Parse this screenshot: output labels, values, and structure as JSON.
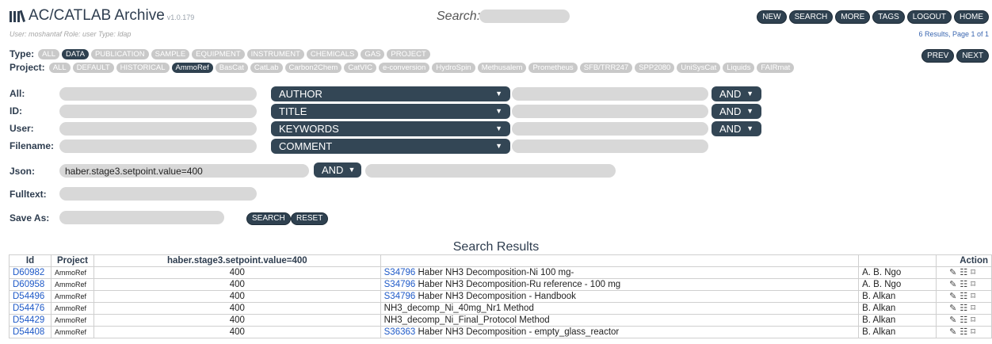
{
  "header": {
    "title": "AC/CATLAB Archive",
    "version": "v1.0.179",
    "search_label": "Search:",
    "search_value": "",
    "nav": [
      "NEW",
      "SEARCH",
      "MORE",
      "TAGS",
      "LOGOUT",
      "HOME"
    ]
  },
  "user_info": "User: moshantaf   Role: user   Type: ldap",
  "results_info": "6 Results,   Page 1 of 1",
  "type_filter": {
    "label": "Type:",
    "items": [
      "ALL",
      "DATA",
      "PUBLICATION",
      "SAMPLE",
      "EQUIPMENT",
      "INSTRUMENT",
      "CHEMICALS",
      "GAS",
      "PROJECT"
    ],
    "selected": "DATA"
  },
  "project_filter": {
    "label": "Project:",
    "items": [
      "ALL",
      "DEFAULT",
      "HISTORICAL",
      "AmmoRef",
      "BasCat",
      "CatLab",
      "Carbon2Chem",
      "CatVIC",
      "e-conversion",
      "HydroSpin",
      "Methusalem",
      "Prometheus",
      "SFB/TRR247",
      "SPP2080",
      "UniSysCat",
      "Liquids",
      "FAIRmat"
    ],
    "selected": "AmmoRef"
  },
  "pager": [
    "PREV",
    "NEXT"
  ],
  "form": {
    "labels": {
      "all": "All:",
      "id": "ID:",
      "user": "User:",
      "filename": "Filename:",
      "json": "Json:",
      "fulltext": "Fulltext:",
      "save_as": "Save As:"
    },
    "field_selects": [
      "AUTHOR",
      "TITLE",
      "KEYWORDS",
      "COMMENT"
    ],
    "operators": [
      "AND",
      "AND",
      "AND"
    ],
    "json_value": "haber.stage3.setpoint.value=400",
    "json_operator": "AND",
    "buttons": {
      "search": "SEARCH",
      "reset": "RESET"
    }
  },
  "results": {
    "title": "Search Results",
    "columns": {
      "id": "Id",
      "project": "Project",
      "value": "haber.stage3.setpoint.value=400",
      "title": "",
      "user": "",
      "action": "Action"
    },
    "rows": [
      {
        "id": "D60982",
        "project": "AmmoRef",
        "value": "400",
        "link": "S34796",
        "title": "Haber NH3 Decomposition-Ni 100 mg-",
        "user": "A. B. Ngo"
      },
      {
        "id": "D60958",
        "project": "AmmoRef",
        "value": "400",
        "link": "S34796",
        "title": "Haber NH3 Decomposition-Ru reference - 100 mg",
        "user": "A. B. Ngo"
      },
      {
        "id": "D54496",
        "project": "AmmoRef",
        "value": "400",
        "link": "S34796",
        "title": "Haber NH3 Decomposition - Handbook",
        "user": "B. Alkan"
      },
      {
        "id": "D54476",
        "project": "AmmoRef",
        "value": "400",
        "link": "",
        "title": "NH3_decomp_Ni_40mg_Nr1 Method",
        "user": "B. Alkan"
      },
      {
        "id": "D54429",
        "project": "AmmoRef",
        "value": "400",
        "link": "",
        "title": "NH3_decomp_Ni_Final_Protocol Method",
        "user": "B. Alkan"
      },
      {
        "id": "D54408",
        "project": "AmmoRef",
        "value": "400",
        "link": "S36363",
        "title": "Haber NH3 Decomposition - empty_glass_reactor",
        "user": "B. Alkan"
      }
    ],
    "action_icons": [
      "pencil-icon",
      "comment-icon",
      "bookmark-icon"
    ]
  },
  "colors": {
    "brand_dark": "#2f4150",
    "pill_light": "#c9c9c9",
    "link": "#1f5ac8",
    "field_bg": "#d8d8d8"
  }
}
